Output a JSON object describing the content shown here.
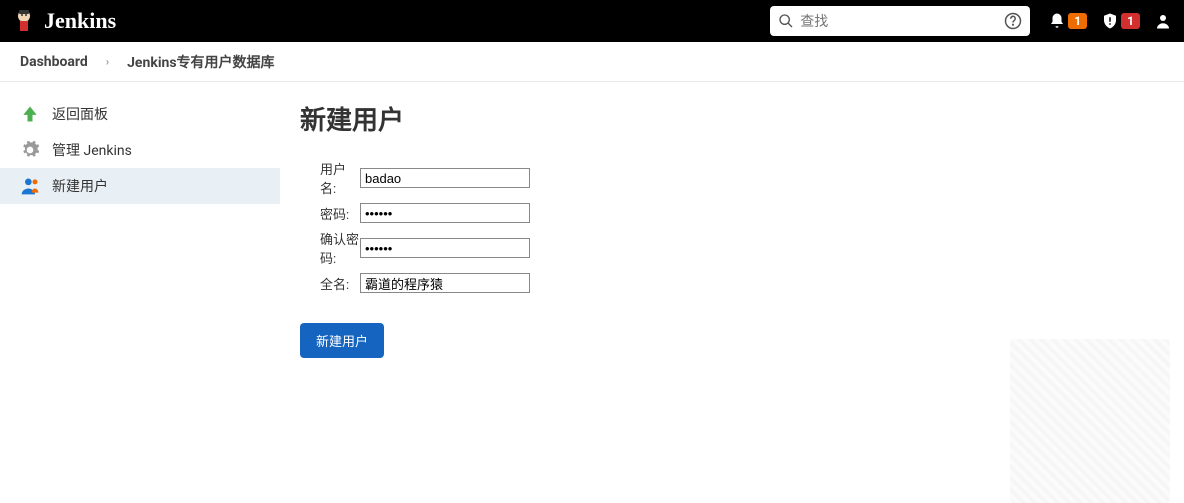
{
  "header": {
    "brand": "Jenkins",
    "search_placeholder": "查找",
    "notification_badge": "1",
    "alert_badge": "1"
  },
  "breadcrumbs": {
    "items": [
      {
        "label": "Dashboard"
      },
      {
        "label": "Jenkins专有用户数据库"
      }
    ]
  },
  "sidebar": {
    "items": [
      {
        "label": "返回面板",
        "icon": "arrow-up",
        "color": "#4caf50"
      },
      {
        "label": "管理 Jenkins",
        "icon": "gear",
        "color": "#888"
      },
      {
        "label": "新建用户",
        "icon": "user",
        "color": "#1976d2"
      }
    ]
  },
  "main": {
    "title": "新建用户",
    "form": {
      "username_label": "用户名:",
      "username_value": "badao",
      "password_label": "密码:",
      "password_value": "••••••",
      "confirm_label": "确认密码:",
      "confirm_value": "••••••",
      "fullname_label": "全名:",
      "fullname_value": "霸道的程序猿"
    },
    "submit_label": "新建用户"
  }
}
